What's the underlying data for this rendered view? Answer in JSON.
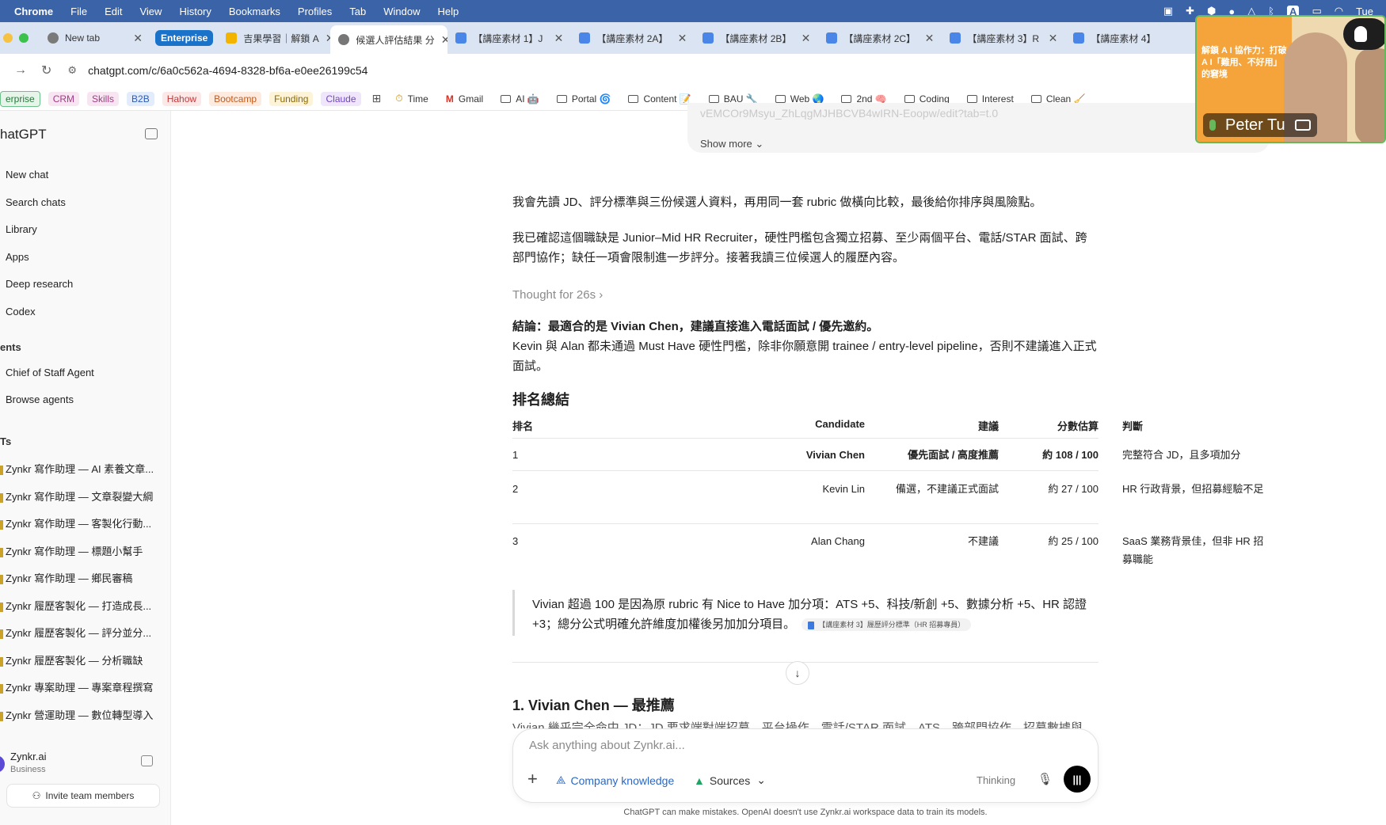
{
  "menubar": {
    "app": "Chrome",
    "items": [
      "File",
      "Edit",
      "View",
      "History",
      "Bookmarks",
      "Profiles",
      "Tab",
      "Window",
      "Help"
    ],
    "tray_badge": "A",
    "clock": "Tue"
  },
  "tabs": {
    "new_tab": "New tab",
    "group_label": "Enterprise",
    "items": [
      {
        "title": "吉果學習｜解鎖 A",
        "color": "#f3b400"
      },
      {
        "title": "候選人評估結果 分",
        "color": "#777777"
      },
      {
        "title": "【講座素材 1】J",
        "color": "#4a86e8"
      },
      {
        "title": "【講座素材 2A】",
        "color": "#4a86e8"
      },
      {
        "title": "【講座素材 2B】",
        "color": "#4a86e8"
      },
      {
        "title": "【講座素材 2C】",
        "color": "#4a86e8"
      },
      {
        "title": "【講座素材 3】R",
        "color": "#4a86e8"
      },
      {
        "title": "【講座素材 4】",
        "color": "#4a86e8"
      }
    ]
  },
  "address": {
    "url": "chatgpt.com/c/6a0c562a-4694-8328-bf6a-e0ee26199c54"
  },
  "bookmarks": {
    "chips": [
      {
        "label": "erprise",
        "bg": "#e6f4ea",
        "fg": "#1e7e34",
        "border": "#6cc08a"
      },
      {
        "label": "CRM",
        "bg": "#f7e6f1",
        "fg": "#a13c83",
        "border": "#f7e6f1"
      },
      {
        "label": "Skills",
        "bg": "#f7e6f1",
        "fg": "#a13c83",
        "border": "#f7e6f1"
      },
      {
        "label": "B2B",
        "bg": "#e3ecfb",
        "fg": "#2d5bb8",
        "border": "#e3ecfb"
      },
      {
        "label": "Hahow",
        "bg": "#fde8e8",
        "fg": "#c23b3b",
        "border": "#fde8e8"
      },
      {
        "label": "Bootcamp",
        "bg": "#fdebe0",
        "fg": "#c25a1c",
        "border": "#fdebe0"
      },
      {
        "label": "Funding",
        "bg": "#fdf3d8",
        "fg": "#8a6a00",
        "border": "#fdf3d8"
      },
      {
        "label": "Claude",
        "bg": "#efe6fb",
        "fg": "#7446c2",
        "border": "#efe6fb"
      }
    ],
    "items": [
      {
        "label": "Time",
        "icon": "clock-icon"
      },
      {
        "label": "Gmail",
        "icon": "gmail-icon"
      },
      {
        "label": "AI 🤖",
        "icon": "folder-icon"
      },
      {
        "label": "Portal 🌀",
        "icon": "folder-icon"
      },
      {
        "label": "Content 📝",
        "icon": "folder-icon"
      },
      {
        "label": "BAU 🔧",
        "icon": "folder-icon"
      },
      {
        "label": "Web 🌏",
        "icon": "folder-icon"
      },
      {
        "label": "2nd 🧠",
        "icon": "folder-icon"
      },
      {
        "label": "Coding",
        "icon": "folder-icon"
      },
      {
        "label": "Interest",
        "icon": "folder-icon"
      },
      {
        "label": "Clean 🧹",
        "icon": "folder-icon"
      }
    ]
  },
  "sidebar": {
    "title": "hatGPT",
    "nav": [
      "New chat",
      "Search chats",
      "Library",
      "Apps",
      "Deep research",
      "Codex"
    ],
    "agents_section": "ents",
    "agents": [
      "Chief of Staff Agent",
      "Browse agents"
    ],
    "gpts_section": "Ts",
    "gpts": [
      "Zynkr 寫作助理 — AI 素養文章...",
      "Zynkr 寫作助理 — 文章裂變大綱",
      "Zynkr 寫作助理 — 客製化行動...",
      "Zynkr 寫作助理 — 標題小幫手",
      "Zynkr 寫作助理 — 鄉民審稿",
      "Zynkr 履歷客製化 — 打造成長...",
      "Zynkr 履歷客製化 — 評分並分...",
      "Zynkr 履歷客製化 — 分析職缺",
      "Zynkr 專案助理 — 專案章程撰寫",
      "Zynkr 營運助理 — 數位轉型導入"
    ],
    "user_name": "Zynkr.ai",
    "user_plan": "Business",
    "invite": "Invite team members"
  },
  "chat": {
    "prev_link": "vEMCOr9Msyu_ZhLqgMJHBCVB4wIRN-Eoopw/edit?tab=t.0",
    "show_more": "Show more",
    "p1": "我會先讀 JD、評分標準與三份候選人資料，再用同一套 rubric 做橫向比較，最後給你排序與風險點。",
    "p2": "我已確認這個職缺是 Junior–Mid HR Recruiter，硬性門檻包含獨立招募、至少兩個平台、電話/STAR 面試、跨部門協作；缺任一項會限制進一步評分。接著我讀三位候選人的履歷內容。",
    "thought": "Thought for 26s",
    "conclusion_label": "結論：",
    "conclusion_bold": "最適合的是 Vivian Chen，建議直接進入電話面試 / 優先邀約。",
    "conclusion_rest": "Kevin 與 Alan 都未通過 Must Have 硬性門檻，除非你願意開 trainee / entry-level pipeline，否則不建議進入正式面試。",
    "ranking_heading": "排名總結",
    "table": {
      "headers": [
        "排名",
        "Candidate",
        "建議",
        "分數估算",
        "判斷"
      ],
      "rows": [
        {
          "rank": "1",
          "candidate": "Vivian Chen",
          "advice": "優先面試 / 高度推薦",
          "score": "約 108 / 100",
          "judgement": "完整符合 JD，且多項加分"
        },
        {
          "rank": "2",
          "candidate": "Kevin Lin",
          "advice": "備選，不建議正式面試",
          "score": "約 27 / 100",
          "judgement": "HR 行政背景，但招募經驗不足"
        },
        {
          "rank": "3",
          "candidate": "Alan Chang",
          "advice": "不建議",
          "score": "約 25 / 100",
          "judgement": "SaaS 業務背景佳，但非 HR 招募職能"
        }
      ]
    },
    "quote": "Vivian 超過 100 是因為原 rubric 有 Nice to Have 加分項：ATS +5、科技/新創 +5、數據分析 +5、HR 認證 +3；總分公式明確允許維度加權後另加加分項目。",
    "citation": "【講座素材 3】履歷評分標準（HR 招募專員）",
    "section_heading": "1. Vivian Chen — 最推薦",
    "clipped_line": "Vivian 幾乎完全命中 JD：JD 要求端對端招募、平台操作、電話/STAR 面試、ATS、跨部門協作、招募數據與"
  },
  "composer": {
    "placeholder": "Ask anything about Zynkr.ai...",
    "company_knowledge": "Company knowledge",
    "sources": "Sources",
    "thinking": "Thinking",
    "disclaimer": "ChatGPT can make mistakes. OpenAI doesn't use Zynkr.ai workspace data to train its models."
  },
  "video": {
    "slide_text": "解鎖 A I 協作力：打破 A I「難用、不好用」的窘境",
    "name": "Peter Tu"
  }
}
